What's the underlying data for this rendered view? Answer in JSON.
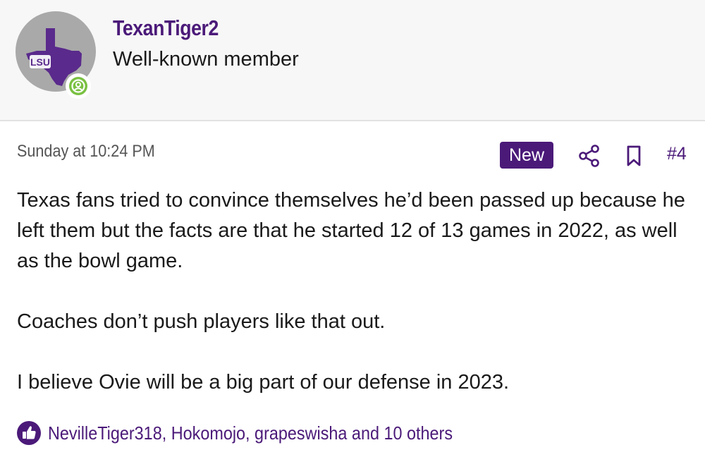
{
  "user": {
    "name": "TexanTiger2",
    "title": "Well-known member",
    "avatar_text": "LSU",
    "avatar_icon": "texas-lsu-avatar",
    "status_icon": "online-user-icon"
  },
  "post": {
    "date": "Sunday at 10:24 PM",
    "new_badge": "New",
    "number": "#4",
    "paragraphs": [
      "Texas fans tried to convince themselves he’d been passed up because he left them but the facts are that he started 12 of 13 games in 2022, as well as the bowl game.",
      "Coaches don’t push players like that out.",
      "I believe Ovie will be a big part of our defense in 2023."
    ]
  },
  "reactions": {
    "icon": "thumbs-up-icon",
    "text": "NevilleTiger318, Hokomojo, grapeswisha and 10 others"
  },
  "colors": {
    "brand": "#4b1a79",
    "online": "#7ac142",
    "avatar_bg": "#a9a9a9",
    "header_bg": "#f7f7f7"
  }
}
